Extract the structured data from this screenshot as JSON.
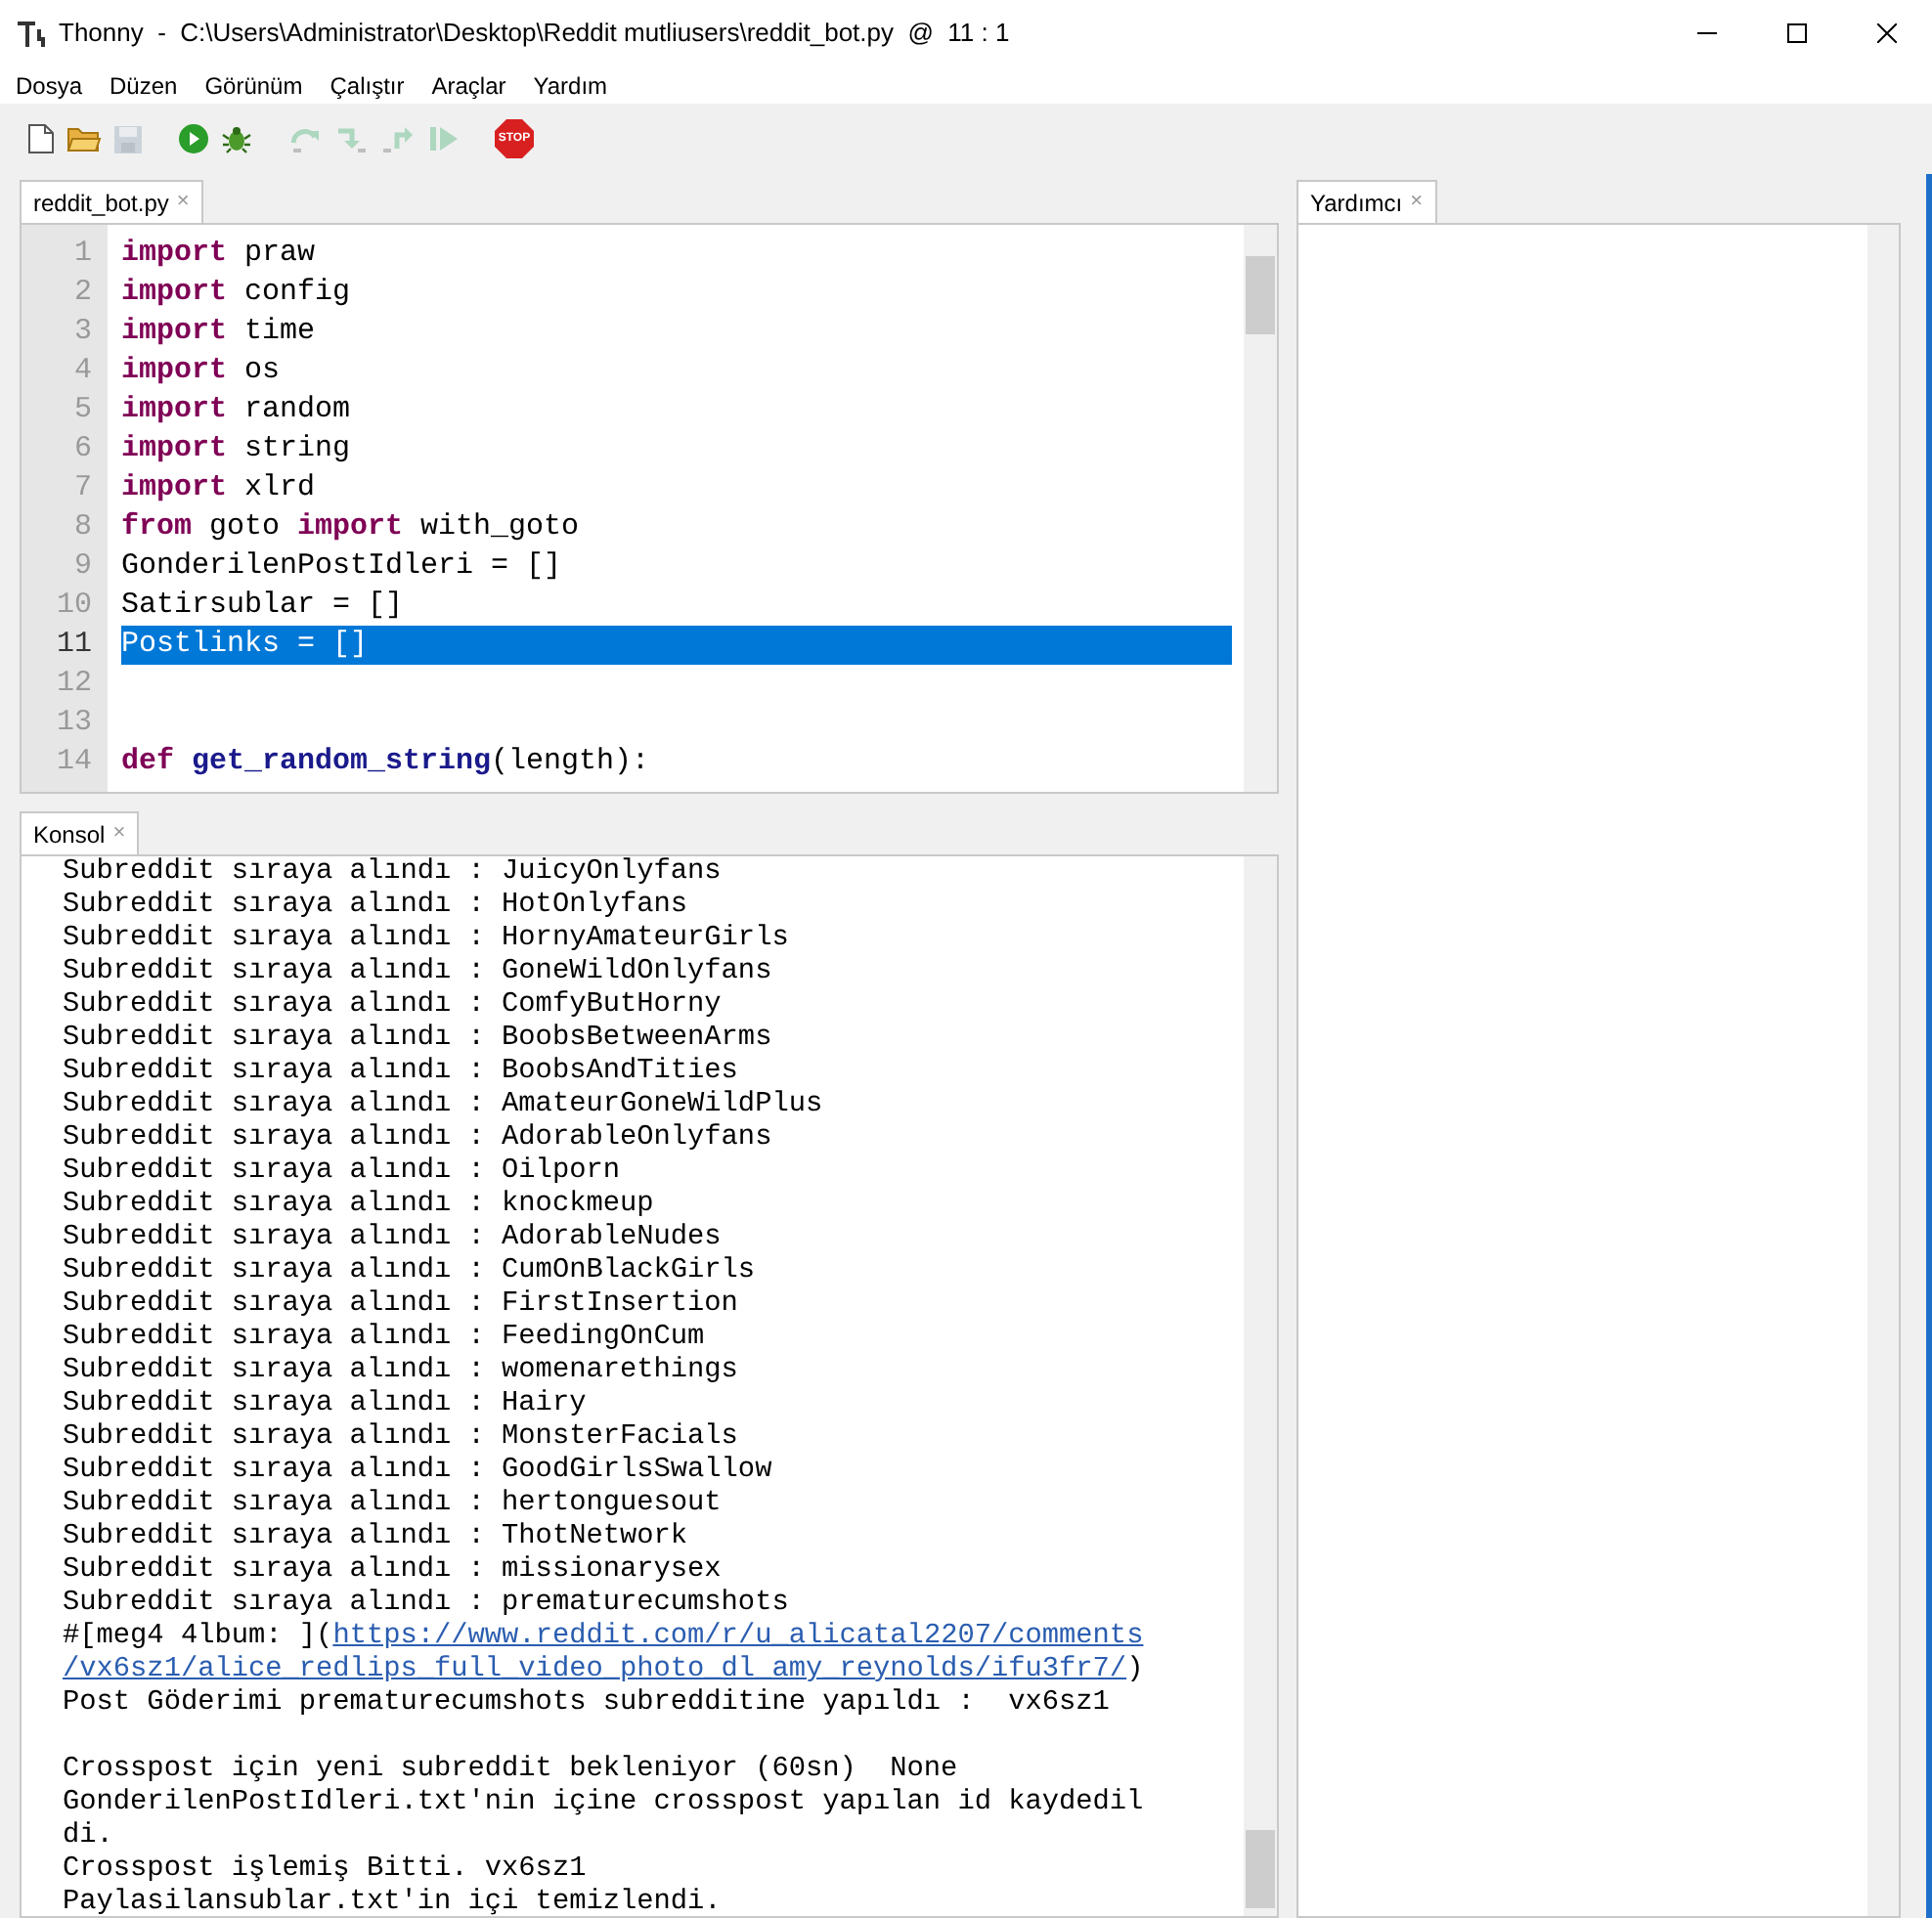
{
  "window": {
    "title": "Thonny  -  C:\\Users\\Administrator\\Desktop\\Reddit mutliusers\\reddit_bot.py  @  11 : 1"
  },
  "menu": [
    "Dosya",
    "Düzen",
    "Görünüm",
    "Çalıştır",
    "Araçlar",
    "Yardım"
  ],
  "toolbar": [
    {
      "kind": "new",
      "disabled": false
    },
    {
      "kind": "open",
      "disabled": false
    },
    {
      "kind": "save",
      "disabled": true
    },
    {
      "kind": "run",
      "disabled": false
    },
    {
      "kind": "debug",
      "disabled": false
    },
    {
      "kind": "step_over",
      "disabled": true
    },
    {
      "kind": "step_into",
      "disabled": true
    },
    {
      "kind": "step_out",
      "disabled": true
    },
    {
      "kind": "resume",
      "disabled": true
    },
    {
      "kind": "stop",
      "disabled": false,
      "label": "STOP"
    }
  ],
  "editor": {
    "tabs": [
      {
        "label": "reddit_bot.py",
        "close": "×",
        "selected": true
      }
    ],
    "lines": [
      {
        "number": "1",
        "selected": false,
        "tokens": [
          {
            "kind": "keyword",
            "text": "import"
          },
          {
            "kind": "plain",
            "text": " praw"
          }
        ]
      },
      {
        "number": "2",
        "selected": false,
        "tokens": [
          {
            "kind": "keyword",
            "text": "import"
          },
          {
            "kind": "plain",
            "text": " config"
          }
        ]
      },
      {
        "number": "3",
        "selected": false,
        "tokens": [
          {
            "kind": "keyword",
            "text": "import"
          },
          {
            "kind": "plain",
            "text": " time"
          }
        ]
      },
      {
        "number": "4",
        "selected": false,
        "tokens": [
          {
            "kind": "keyword",
            "text": "import"
          },
          {
            "kind": "plain",
            "text": " os"
          }
        ]
      },
      {
        "number": "5",
        "selected": false,
        "tokens": [
          {
            "kind": "keyword",
            "text": "import"
          },
          {
            "kind": "plain",
            "text": " random"
          }
        ]
      },
      {
        "number": "6",
        "selected": false,
        "tokens": [
          {
            "kind": "keyword",
            "text": "import"
          },
          {
            "kind": "plain",
            "text": " string"
          }
        ]
      },
      {
        "number": "7",
        "selected": false,
        "tokens": [
          {
            "kind": "keyword",
            "text": "import"
          },
          {
            "kind": "plain",
            "text": " xlrd"
          }
        ]
      },
      {
        "number": "8",
        "selected": false,
        "tokens": [
          {
            "kind": "keyword",
            "text": "from"
          },
          {
            "kind": "plain",
            "text": " goto "
          },
          {
            "kind": "keyword",
            "text": "import"
          },
          {
            "kind": "plain",
            "text": " with_goto"
          }
        ]
      },
      {
        "number": "9",
        "selected": false,
        "tokens": [
          {
            "kind": "plain",
            "text": "GonderilenPostIdleri = []"
          }
        ]
      },
      {
        "number": "10",
        "selected": false,
        "tokens": [
          {
            "kind": "plain",
            "text": "Satirsublar = []"
          }
        ]
      },
      {
        "number": "11",
        "selected": true,
        "tokens": [
          {
            "kind": "plain",
            "text": "Postlinks = []"
          }
        ]
      },
      {
        "number": "12",
        "selected": false
      },
      {
        "number": "13",
        "selected": false
      },
      {
        "number": "14",
        "selected": false,
        "tokens": [
          {
            "kind": "keyword",
            "text": "def "
          },
          {
            "kind": "name",
            "text": "get_random_string"
          },
          {
            "kind": "plain",
            "text": "(length):"
          }
        ]
      }
    ]
  },
  "console": {
    "tabs": [
      {
        "label": "Konsol",
        "close": "×",
        "selected": true
      }
    ],
    "lines": [
      [
        {
          "kind": "plain",
          "text": "Subreddit sıraya alındı : JuicyOnlyfans"
        }
      ],
      [
        {
          "kind": "plain",
          "text": "Subreddit sıraya alındı : HotOnlyfans"
        }
      ],
      [
        {
          "kind": "plain",
          "text": "Subreddit sıraya alındı : HornyAmateurGirls"
        }
      ],
      [
        {
          "kind": "plain",
          "text": "Subreddit sıraya alındı : GoneWildOnlyfans"
        }
      ],
      [
        {
          "kind": "plain",
          "text": "Subreddit sıraya alındı : ComfyButHorny"
        }
      ],
      [
        {
          "kind": "plain",
          "text": "Subreddit sıraya alındı : BoobsBetweenArms"
        }
      ],
      [
        {
          "kind": "plain",
          "text": "Subreddit sıraya alındı : BoobsAndTities"
        }
      ],
      [
        {
          "kind": "plain",
          "text": "Subreddit sıraya alındı : AmateurGoneWildPlus"
        }
      ],
      [
        {
          "kind": "plain",
          "text": "Subreddit sıraya alındı : AdorableOnlyfans"
        }
      ],
      [
        {
          "kind": "plain",
          "text": "Subreddit sıraya alındı : Oilporn"
        }
      ],
      [
        {
          "kind": "plain",
          "text": "Subreddit sıraya alındı : knockmeup"
        }
      ],
      [
        {
          "kind": "plain",
          "text": "Subreddit sıraya alındı : AdorableNudes"
        }
      ],
      [
        {
          "kind": "plain",
          "text": "Subreddit sıraya alındı : CumOnBlackGirls"
        }
      ],
      [
        {
          "kind": "plain",
          "text": "Subreddit sıraya alındı : FirstInsertion"
        }
      ],
      [
        {
          "kind": "plain",
          "text": "Subreddit sıraya alındı : FeedingOnCum"
        }
      ],
      [
        {
          "kind": "plain",
          "text": "Subreddit sıraya alındı : womenarethings"
        }
      ],
      [
        {
          "kind": "plain",
          "text": "Subreddit sıraya alındı : Hairy"
        }
      ],
      [
        {
          "kind": "plain",
          "text": "Subreddit sıraya alındı : MonsterFacials"
        }
      ],
      [
        {
          "kind": "plain",
          "text": "Subreddit sıraya alındı : GoodGirlsSwallow"
        }
      ],
      [
        {
          "kind": "plain",
          "text": "Subreddit sıraya alındı : hertonguesout"
        }
      ],
      [
        {
          "kind": "plain",
          "text": "Subreddit sıraya alındı : ThotNetwork"
        }
      ],
      [
        {
          "kind": "plain",
          "text": "Subreddit sıraya alındı : missionarysex"
        }
      ],
      [
        {
          "kind": "plain",
          "text": "Subreddit sıraya alındı : prematurecumshots"
        }
      ],
      [
        {
          "kind": "plain",
          "text": "#[meg4 4lbum: ]("
        },
        {
          "kind": "link",
          "text": "https://www.reddit.com/r/u_alicatal2207/comments"
        }
      ],
      [
        {
          "kind": "link",
          "text": "/vx6sz1/alice_redlips_full_video_photo_dl_amy_reynolds/ifu3fr7/"
        },
        {
          "kind": "plain",
          "text": ")"
        }
      ],
      [
        {
          "kind": "plain",
          "text": "Post Göderimi prematurecumshots subredditine yapıldı :  vx6sz1"
        }
      ],
      {
        "kind": "blank"
      },
      [
        {
          "kind": "plain",
          "text": "Crosspost için yeni subreddit bekleniyor (60sn)  None"
        }
      ],
      [
        {
          "kind": "plain",
          "text": "GonderilenPostIdleri.txt'nin içine crosspost yapılan id kaydedil"
        }
      ],
      [
        {
          "kind": "plain",
          "text": "di."
        }
      ],
      [
        {
          "kind": "plain",
          "text": "Crosspost işlemiş Bitti. vx6sz1"
        }
      ],
      [
        {
          "kind": "plain",
          "text": "Paylasilansublar.txt'in içi temizlendi."
        }
      ]
    ]
  },
  "assistant": {
    "tabs": [
      {
        "label": "Yardımcı",
        "close": "×",
        "selected": true
      }
    ]
  }
}
